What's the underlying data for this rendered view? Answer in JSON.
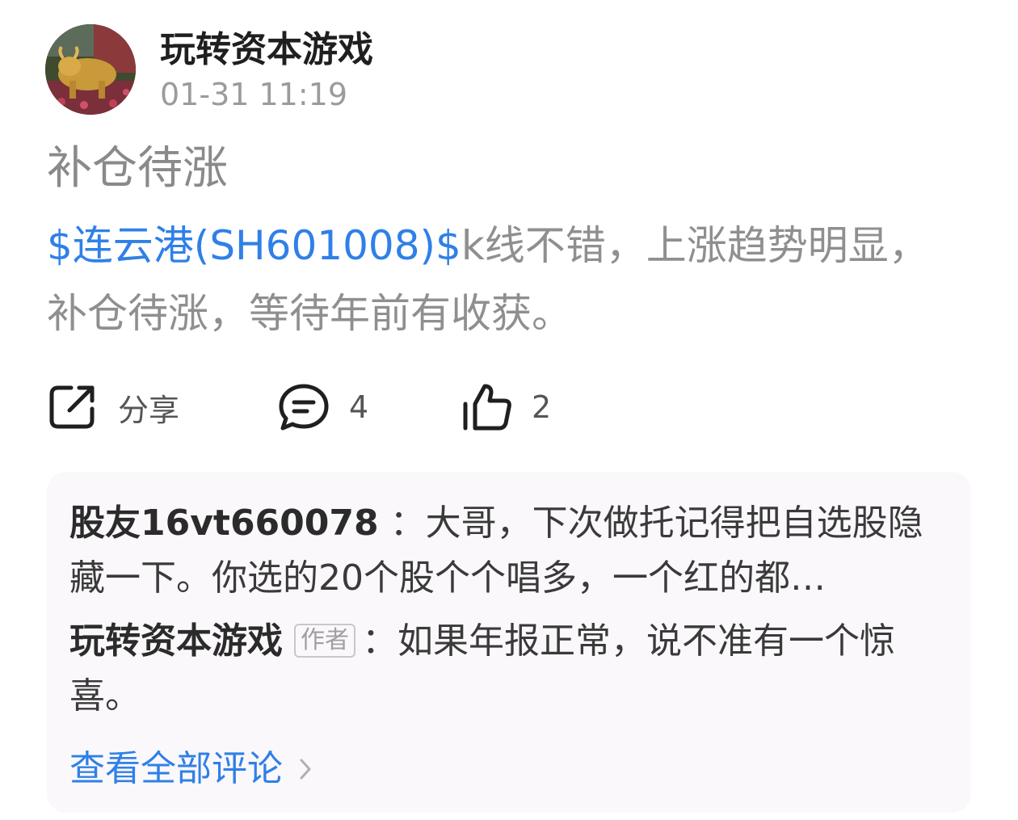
{
  "post": {
    "author": "玩转资本游戏",
    "time": "01-31 11:19",
    "title": "补仓待涨",
    "stock_link": "$连云港(SH601008)$",
    "body": "k线不错，上涨趋势明显，补仓待涨，等待年前有收获。"
  },
  "actions": {
    "share_label": "分享",
    "comment_count": "4",
    "like_count": "2"
  },
  "comments": [
    {
      "user": "股友16vt660078",
      "separator": "：",
      "text": "大哥，下次做托记得把自选股隐藏一下。你选的20个股个个唱多，一个红的都…"
    },
    {
      "user": "玩转资本游戏",
      "badge": "作者",
      "separator": "：",
      "text": "如果年报正常，说不准有一个惊喜。"
    }
  ],
  "view_all_label": "查看全部评论",
  "icons": {
    "share": "share-icon",
    "comment": "comment-icon",
    "like": "thumbs-up-icon",
    "chevron": "chevron-right-icon"
  },
  "colors": {
    "link": "#2f80e7",
    "comment_bg": "#fbf8fb"
  }
}
